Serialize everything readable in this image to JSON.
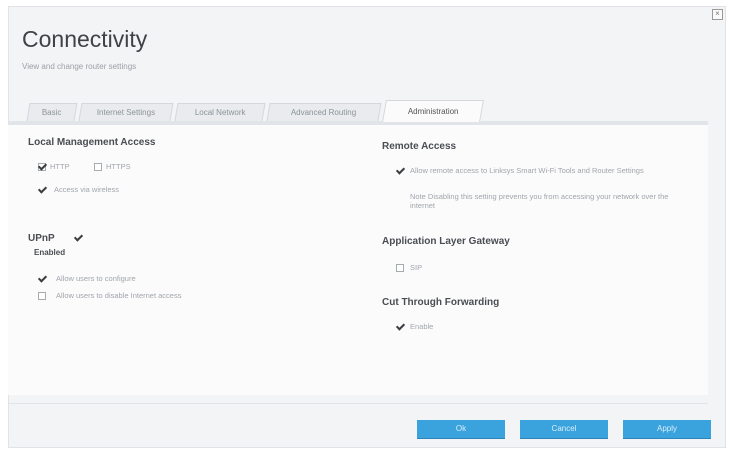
{
  "page": {
    "title": "Connectivity",
    "subtitle": "View and change router settings"
  },
  "tabs": [
    {
      "label": "Basic"
    },
    {
      "label": "Internet Settings"
    },
    {
      "label": "Local Network"
    },
    {
      "label": "Advanced Routing"
    },
    {
      "label": "Administration",
      "active": true
    }
  ],
  "local_management": {
    "title": "Local Management Access",
    "http_label": "HTTP",
    "http_checked": true,
    "https_label": "HTTPS",
    "https_checked": false,
    "wireless_label": "Access via wireless",
    "wireless_checked": true
  },
  "upnp": {
    "title": "UPnP",
    "enabled_label": "Enabled",
    "enabled_checked": true,
    "allow_configure_label": "Allow users to configure",
    "allow_configure_checked": true,
    "allow_disable_label": "Allow users to disable Internet access",
    "allow_disable_checked": false
  },
  "remote_access": {
    "title": "Remote Access",
    "allow_label": "Allow remote access to Linksys Smart Wi-Fi Tools and Router Settings",
    "allow_checked": true,
    "note": "Note Disabling this setting prevents you from accessing your network over the internet"
  },
  "alg": {
    "title": "Application Layer Gateway",
    "sip_label": "SIP",
    "sip_checked": false
  },
  "ctf": {
    "title": "Cut Through Forwarding",
    "enable_label": "Enable",
    "enable_checked": true
  },
  "buttons": {
    "ok": "Ok",
    "cancel": "Cancel",
    "apply": "Apply"
  },
  "colors": {
    "accent": "#3aa3de",
    "background": "#f3f4f6"
  }
}
